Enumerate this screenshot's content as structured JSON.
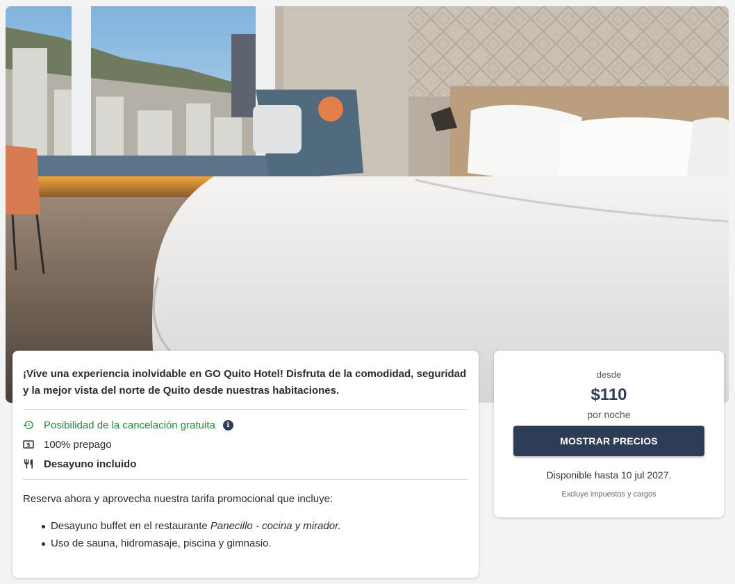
{
  "hero": {
    "image": "hotel-room-photo",
    "scene": "hotel-room-photo"
  },
  "offer": {
    "headline": "¡Vive una experiencia inolvidable en GO Quito Hotel! Disfruta de la comodidad, seguridad y la mejor vista del norte de Quito desde nuestras habitaciones.",
    "features": [
      {
        "icon": "history-icon",
        "label": "Posibilidad de la cancelación gratuita",
        "color": "#1a8a3a"
      },
      {
        "icon": "dollar-bill-icon",
        "label": "100% prepago"
      },
      {
        "icon": "fork-knife-icon",
        "label": "Desayuno incluido"
      }
    ],
    "info_icon": "info-icon",
    "promo_intro": "Reserva ahora y aprovecha nuestra tarifa promocional que incluye:",
    "promo_items": [
      {
        "text": "Desayuno buffet en el restaurante ",
        "emphasis": "Panecillo - cocina y mirador."
      },
      {
        "text": "Uso de sauna, hidromasaje, piscina y gimnasio."
      }
    ]
  },
  "pricing": {
    "from_label": "desde",
    "price": "$110",
    "per_night": "por noche",
    "button_label": "MOSTRAR PRECIOS",
    "availability": "Disponible hasta 10 jul 2027.",
    "taxes_note": "Excluye impuestos y cargos"
  },
  "colors": {
    "primary": "#2e3d55",
    "success": "#1a8a3a",
    "page_bg": "#f3f3f3"
  }
}
